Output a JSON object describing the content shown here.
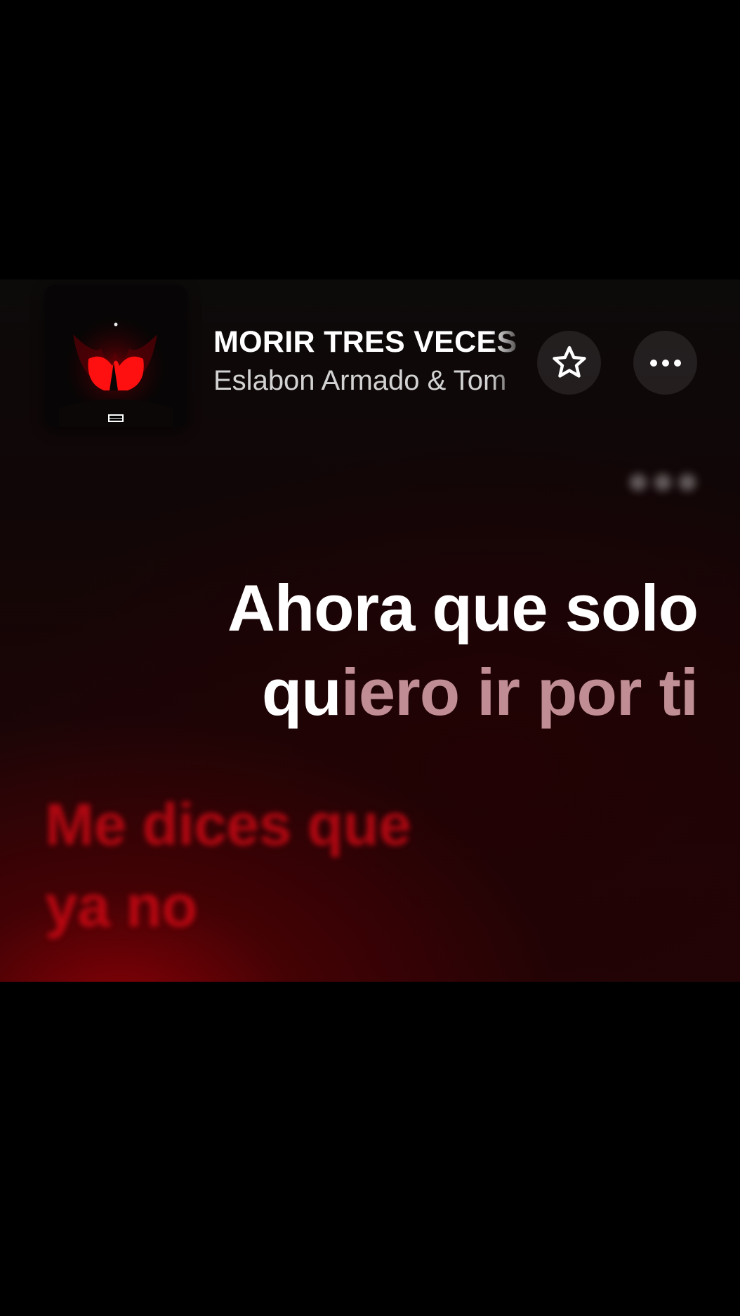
{
  "song": {
    "title": "MORIR TRES VECES",
    "artist": "Eslabon Armado & Tom"
  },
  "controls": {
    "favorite_icon": "star-outline-icon",
    "more_icon": "ellipsis-icon"
  },
  "lyrics": {
    "current_line_1": "Ahora que solo",
    "current_line_2_sung": "qu",
    "current_line_2_pending": "iero ir por ti",
    "next_line_1": "Me dices que",
    "next_line_2": "ya no"
  },
  "colors": {
    "accent_red": "#e00a16",
    "background": "#000000"
  }
}
